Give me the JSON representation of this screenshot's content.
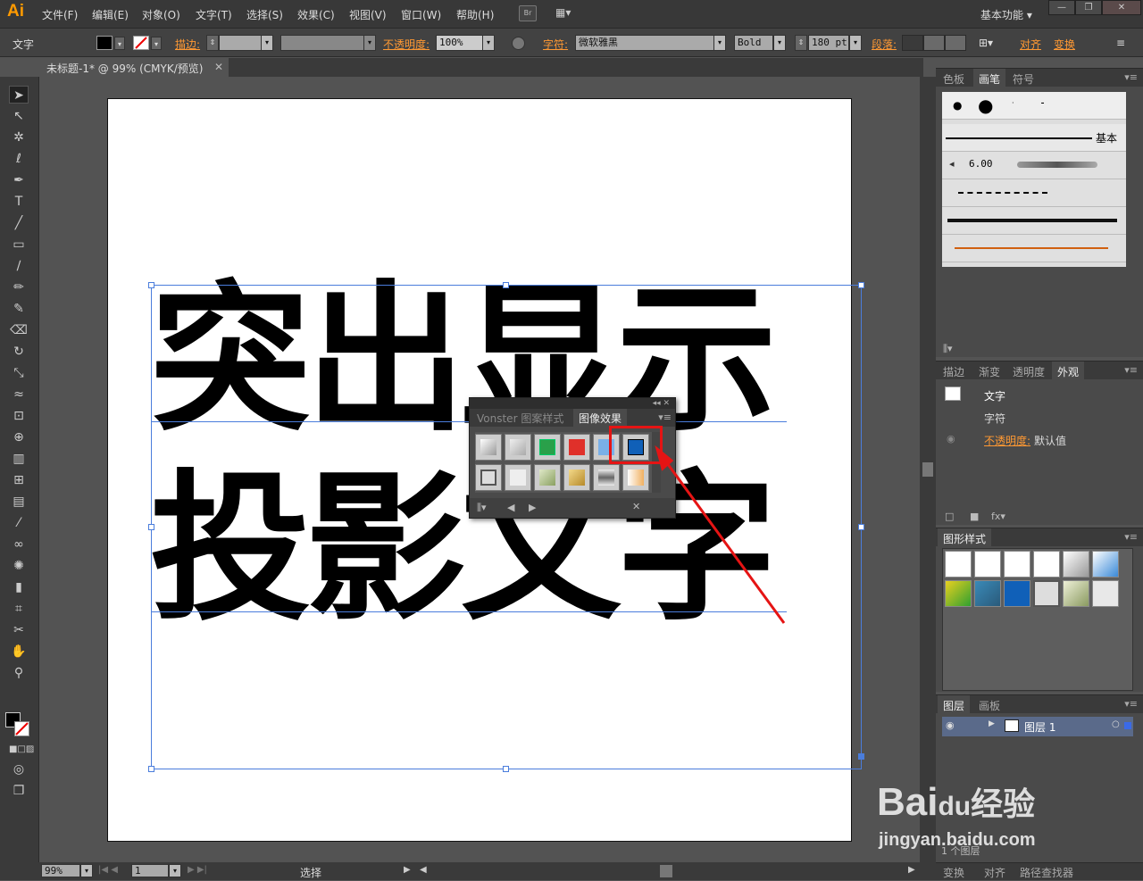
{
  "app": {
    "logo": "Ai",
    "menu": [
      "文件(F)",
      "编辑(E)",
      "对象(O)",
      "文字(T)",
      "选择(S)",
      "效果(C)",
      "视图(V)",
      "窗口(W)",
      "帮助(H)"
    ],
    "bridge": "Br",
    "workspace": "基本功能 ▾"
  },
  "control": {
    "tool_name": "文字",
    "stroke_label": "描边:",
    "opacity_label": "不透明度:",
    "opacity_value": "100%",
    "char_label": "字符:",
    "font_name": "微软雅黑",
    "font_style": "Bold",
    "font_size": "180 pt",
    "paragraph_label": "段落:",
    "align_label": "对齐",
    "transform_label": "变换"
  },
  "document": {
    "tab_title": "未标题-1* @ 99% (CMYK/预览)",
    "line1": "突出显示",
    "line2": "投影文字"
  },
  "graphic_style_float": {
    "tab1": "Vonster 图案样式",
    "tab2": "图像效果",
    "ctrl": "◂◂ ✕"
  },
  "panels": {
    "brushes": {
      "tabs": [
        "色板",
        "画笔",
        "符号"
      ],
      "basic": "基本",
      "size": "6.00"
    },
    "appearance": {
      "tabs": [
        "描边",
        "渐变",
        "透明度",
        "外观"
      ],
      "title": "文字",
      "char": "字符",
      "opacity_label": "不透明度:",
      "opacity_value": "默认值"
    },
    "graphic_styles": {
      "title": "图形样式"
    },
    "layers": {
      "tabs": [
        "图层",
        "画板"
      ],
      "layer_name": "图层 1",
      "count": "1 个图层"
    },
    "bottom": {
      "tabs": [
        "变换",
        "对齐",
        "路径查找器"
      ]
    }
  },
  "status": {
    "zoom": "99%",
    "page": "1",
    "mode": "选择"
  },
  "watermark": {
    "brand": "Bai",
    "brand2": "经验",
    "url": "jingyan.baidu.com"
  },
  "colors": {
    "accent": "#ff9933",
    "selection": "#4a7ddc",
    "highlight": "#e51414"
  }
}
